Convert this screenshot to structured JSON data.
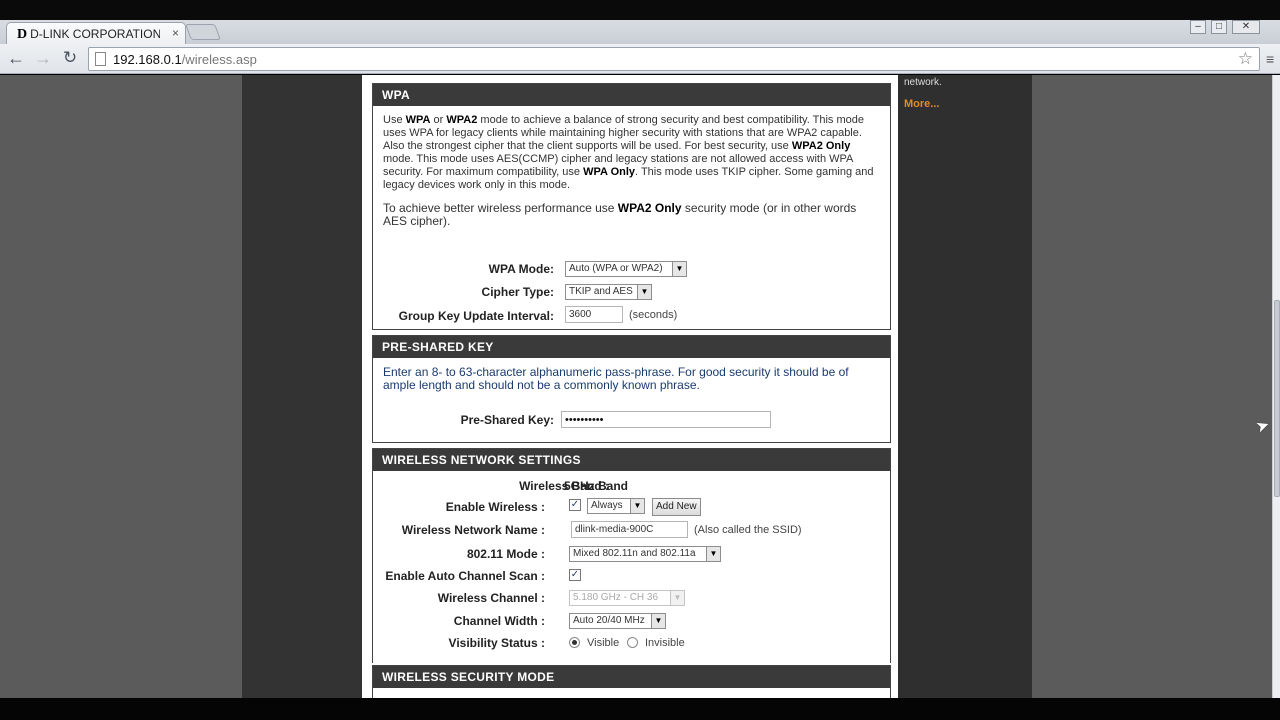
{
  "browser": {
    "tab_favicon": "D",
    "tab_title": "D-LINK CORPORATION, I",
    "tab_close": "×",
    "url_host": "192.168.0.1",
    "url_path": "/wireless.asp",
    "icons": [
      "back-icon",
      "forward-icon",
      "reload-icon",
      "page-icon",
      "star-icon",
      "menu-icon",
      "minimize-icon",
      "maximize-icon",
      "close-icon"
    ]
  },
  "sidebar_right": {
    "fragment": "network.",
    "more": "More..."
  },
  "wpa": {
    "title": "WPA",
    "para1_a": "Use ",
    "para1_b1": "WPA",
    "para1_c": " or ",
    "para1_b2": "WPA2",
    "para1_d": " mode to achieve a balance of strong security and best compatibility. This mode uses WPA for legacy clients while maintaining higher security with stations that are WPA2 capable. Also the strongest cipher that the client supports will be used. For best security, use ",
    "para1_b3": "WPA2 Only",
    "para1_e": " mode. This mode uses AES(CCMP) cipher and legacy stations are not allowed access with WPA security. For maximum compatibility, use ",
    "para1_b4": "WPA Only",
    "para1_f": ". This mode uses TKIP cipher. Some gaming and legacy devices work only in this mode.",
    "para2_a": "To achieve better wireless performance use ",
    "para2_b": "WPA2 Only",
    "para2_c": " security mode (or in other words AES cipher).",
    "wpa_mode_label": "WPA Mode:",
    "wpa_mode_value": "Auto (WPA or WPA2)",
    "cipher_label": "Cipher Type:",
    "cipher_value": "TKIP and AES",
    "gkui_label": "Group Key Update Interval:",
    "gkui_value": "3600",
    "gkui_unit": "(seconds)"
  },
  "psk": {
    "title": "PRE-SHARED KEY",
    "desc": "Enter an 8- to 63-character alphanumeric pass-phrase. For good security it should be of ample length and should not be a commonly known phrase.",
    "label": "Pre-Shared Key:",
    "value": "••••••••••"
  },
  "wns": {
    "title": "WIRELESS NETWORK SETTINGS",
    "band_label": "Wireless Band :",
    "band_value": "5GHz Band",
    "enable_label": "Enable Wireless :",
    "enable_checked": "✓",
    "schedule_value": "Always",
    "add_new": "Add New",
    "ssid_label": "Wireless Network Name :",
    "ssid_value": "dlink-media-900C",
    "ssid_note": "(Also called the SSID)",
    "mode_label": "802.11 Mode :",
    "mode_value": "Mixed 802.11n and 802.11a",
    "auto_scan_label": "Enable Auto Channel Scan :",
    "auto_scan_checked": "✓",
    "channel_label": "Wireless Channel :",
    "channel_value": "5.180 GHz - CH 36",
    "width_label": "Channel Width :",
    "width_value": "Auto 20/40 MHz",
    "visibility_label": "Visibility Status :",
    "visible": "Visible",
    "invisible": "Invisible"
  },
  "wsm": {
    "title": "WIRELESS SECURITY MODE"
  }
}
